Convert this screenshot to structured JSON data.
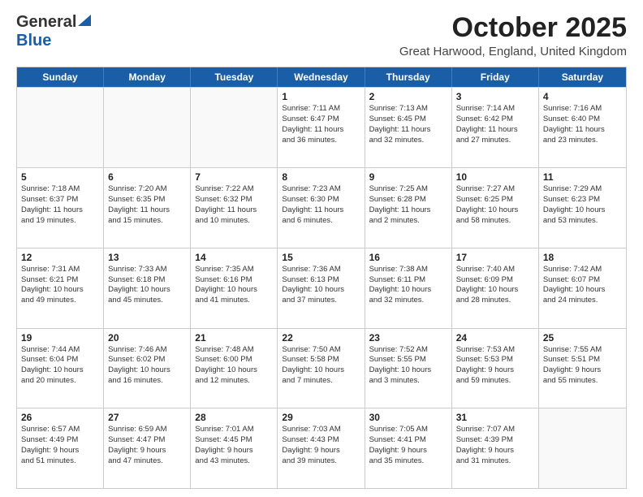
{
  "header": {
    "logo_line1": "General",
    "logo_line2": "Blue",
    "month_title": "October 2025",
    "location": "Great Harwood, England, United Kingdom"
  },
  "calendar": {
    "days_of_week": [
      "Sunday",
      "Monday",
      "Tuesday",
      "Wednesday",
      "Thursday",
      "Friday",
      "Saturday"
    ],
    "weeks": [
      [
        {
          "day": "",
          "info": ""
        },
        {
          "day": "",
          "info": ""
        },
        {
          "day": "",
          "info": ""
        },
        {
          "day": "1",
          "info": "Sunrise: 7:11 AM\nSunset: 6:47 PM\nDaylight: 11 hours\nand 36 minutes."
        },
        {
          "day": "2",
          "info": "Sunrise: 7:13 AM\nSunset: 6:45 PM\nDaylight: 11 hours\nand 32 minutes."
        },
        {
          "day": "3",
          "info": "Sunrise: 7:14 AM\nSunset: 6:42 PM\nDaylight: 11 hours\nand 27 minutes."
        },
        {
          "day": "4",
          "info": "Sunrise: 7:16 AM\nSunset: 6:40 PM\nDaylight: 11 hours\nand 23 minutes."
        }
      ],
      [
        {
          "day": "5",
          "info": "Sunrise: 7:18 AM\nSunset: 6:37 PM\nDaylight: 11 hours\nand 19 minutes."
        },
        {
          "day": "6",
          "info": "Sunrise: 7:20 AM\nSunset: 6:35 PM\nDaylight: 11 hours\nand 15 minutes."
        },
        {
          "day": "7",
          "info": "Sunrise: 7:22 AM\nSunset: 6:32 PM\nDaylight: 11 hours\nand 10 minutes."
        },
        {
          "day": "8",
          "info": "Sunrise: 7:23 AM\nSunset: 6:30 PM\nDaylight: 11 hours\nand 6 minutes."
        },
        {
          "day": "9",
          "info": "Sunrise: 7:25 AM\nSunset: 6:28 PM\nDaylight: 11 hours\nand 2 minutes."
        },
        {
          "day": "10",
          "info": "Sunrise: 7:27 AM\nSunset: 6:25 PM\nDaylight: 10 hours\nand 58 minutes."
        },
        {
          "day": "11",
          "info": "Sunrise: 7:29 AM\nSunset: 6:23 PM\nDaylight: 10 hours\nand 53 minutes."
        }
      ],
      [
        {
          "day": "12",
          "info": "Sunrise: 7:31 AM\nSunset: 6:21 PM\nDaylight: 10 hours\nand 49 minutes."
        },
        {
          "day": "13",
          "info": "Sunrise: 7:33 AM\nSunset: 6:18 PM\nDaylight: 10 hours\nand 45 minutes."
        },
        {
          "day": "14",
          "info": "Sunrise: 7:35 AM\nSunset: 6:16 PM\nDaylight: 10 hours\nand 41 minutes."
        },
        {
          "day": "15",
          "info": "Sunrise: 7:36 AM\nSunset: 6:13 PM\nDaylight: 10 hours\nand 37 minutes."
        },
        {
          "day": "16",
          "info": "Sunrise: 7:38 AM\nSunset: 6:11 PM\nDaylight: 10 hours\nand 32 minutes."
        },
        {
          "day": "17",
          "info": "Sunrise: 7:40 AM\nSunset: 6:09 PM\nDaylight: 10 hours\nand 28 minutes."
        },
        {
          "day": "18",
          "info": "Sunrise: 7:42 AM\nSunset: 6:07 PM\nDaylight: 10 hours\nand 24 minutes."
        }
      ],
      [
        {
          "day": "19",
          "info": "Sunrise: 7:44 AM\nSunset: 6:04 PM\nDaylight: 10 hours\nand 20 minutes."
        },
        {
          "day": "20",
          "info": "Sunrise: 7:46 AM\nSunset: 6:02 PM\nDaylight: 10 hours\nand 16 minutes."
        },
        {
          "day": "21",
          "info": "Sunrise: 7:48 AM\nSunset: 6:00 PM\nDaylight: 10 hours\nand 12 minutes."
        },
        {
          "day": "22",
          "info": "Sunrise: 7:50 AM\nSunset: 5:58 PM\nDaylight: 10 hours\nand 7 minutes."
        },
        {
          "day": "23",
          "info": "Sunrise: 7:52 AM\nSunset: 5:55 PM\nDaylight: 10 hours\nand 3 minutes."
        },
        {
          "day": "24",
          "info": "Sunrise: 7:53 AM\nSunset: 5:53 PM\nDaylight: 9 hours\nand 59 minutes."
        },
        {
          "day": "25",
          "info": "Sunrise: 7:55 AM\nSunset: 5:51 PM\nDaylight: 9 hours\nand 55 minutes."
        }
      ],
      [
        {
          "day": "26",
          "info": "Sunrise: 6:57 AM\nSunset: 4:49 PM\nDaylight: 9 hours\nand 51 minutes."
        },
        {
          "day": "27",
          "info": "Sunrise: 6:59 AM\nSunset: 4:47 PM\nDaylight: 9 hours\nand 47 minutes."
        },
        {
          "day": "28",
          "info": "Sunrise: 7:01 AM\nSunset: 4:45 PM\nDaylight: 9 hours\nand 43 minutes."
        },
        {
          "day": "29",
          "info": "Sunrise: 7:03 AM\nSunset: 4:43 PM\nDaylight: 9 hours\nand 39 minutes."
        },
        {
          "day": "30",
          "info": "Sunrise: 7:05 AM\nSunset: 4:41 PM\nDaylight: 9 hours\nand 35 minutes."
        },
        {
          "day": "31",
          "info": "Sunrise: 7:07 AM\nSunset: 4:39 PM\nDaylight: 9 hours\nand 31 minutes."
        },
        {
          "day": "",
          "info": ""
        }
      ]
    ]
  }
}
